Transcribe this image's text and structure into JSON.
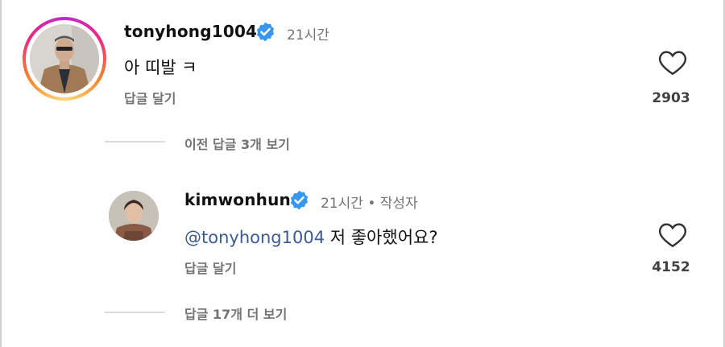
{
  "comment1": {
    "username": "tonyhong1004",
    "time": "21시간",
    "text": "아 띠발 ㅋ",
    "reply_label": "답글 달기",
    "likes": "2903"
  },
  "view_previous": "이전 답글 3개 보기",
  "comment2": {
    "username": "kimwonhun",
    "time": "21시간 • 작성자",
    "mention": "@tonyhong1004",
    "text": " 저 좋아했어요?",
    "reply_label": "답글 달기",
    "likes": "4152"
  },
  "view_more": "답글 17개 더 보기",
  "colors": {
    "verified": "#3797f0",
    "mention": "#3b5b91",
    "muted": "#737373"
  }
}
